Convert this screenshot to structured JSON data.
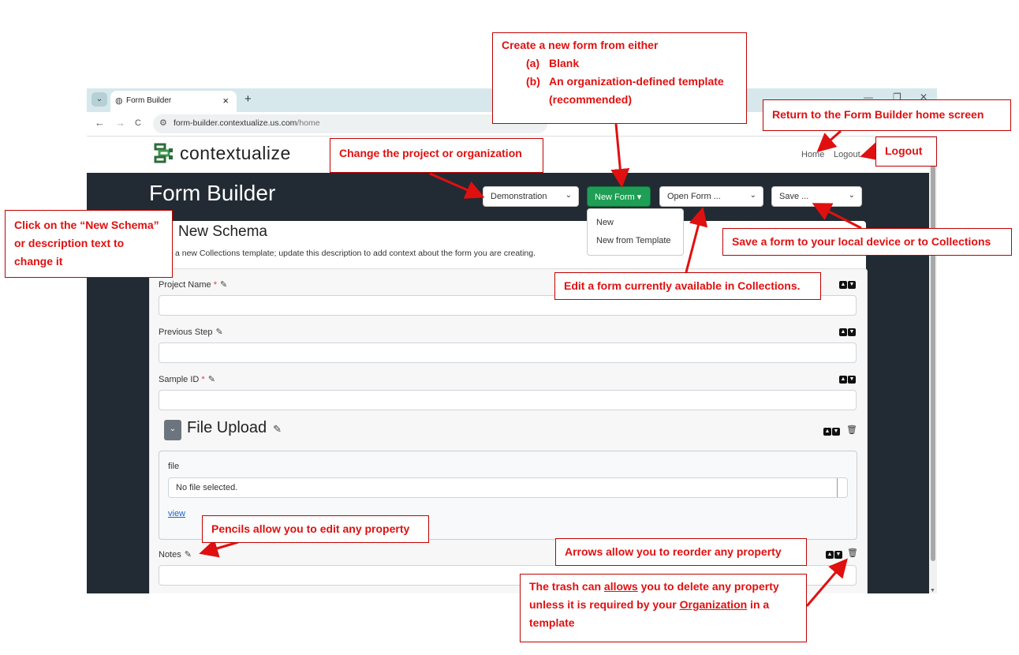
{
  "browser": {
    "tab_title": "Form Builder",
    "url_domain": "form-builder.contextualize.us.com",
    "url_path": "/home",
    "controls": {
      "back": "←",
      "forward": "→",
      "reload": "C",
      "new_tab": "+",
      "close_tab": "×",
      "minimize": "—",
      "restore": "❐",
      "close": "✕"
    }
  },
  "site": {
    "brand": "contextualize",
    "nav": {
      "home": "Home",
      "logout": "Logout"
    }
  },
  "toolbar": {
    "page_title": "Form Builder",
    "project_select": "Demonstration",
    "new_form_label": "New Form ▾",
    "new_form_menu": [
      "New",
      "New from Template"
    ],
    "open_form": "Open Form ...",
    "save": "Save ..."
  },
  "schema": {
    "title": "New Schema",
    "description": "a new Collections template; update this description to add context about the form you are creating."
  },
  "fields": [
    {
      "label": "Project Name",
      "required": "*"
    },
    {
      "label": "Previous Step",
      "required": ""
    },
    {
      "label": "Sample ID",
      "required": "*"
    }
  ],
  "file_upload": {
    "title": "File Upload",
    "file_label": "file",
    "file_status": "No file selected.",
    "view_link": "view"
  },
  "notes_field": {
    "label": "Notes"
  },
  "annotations": {
    "create_title": "Create a new form from either",
    "create_a_marker": "(a)",
    "create_a_text": "Blank",
    "create_b_marker": "(b)",
    "create_b_text": "An organization-defined template",
    "create_b_text2": "(recommended)",
    "return_home": "Return to the Form Builder home screen",
    "logout": "Logout",
    "change_project": "Change the project or organization",
    "click_schema": "Click on the “New Schema” or description text to change it",
    "save_form": "Save a form to your local device or to Collections",
    "edit_form": "Edit a form currently available in Collections.",
    "pencils": "Pencils allow you to edit any property",
    "arrows": "Arrows allow you to reorder any property",
    "trash_pre": "The trash can ",
    "trash_allows": "allows",
    "trash_mid": " you to delete any property unless it is required by your ",
    "trash_org": "Organization",
    "trash_post": " in a template"
  },
  "colors": {
    "annotation_red": "#e01010",
    "dark_band": "#222b33",
    "new_form_green": "#1f9e55"
  }
}
